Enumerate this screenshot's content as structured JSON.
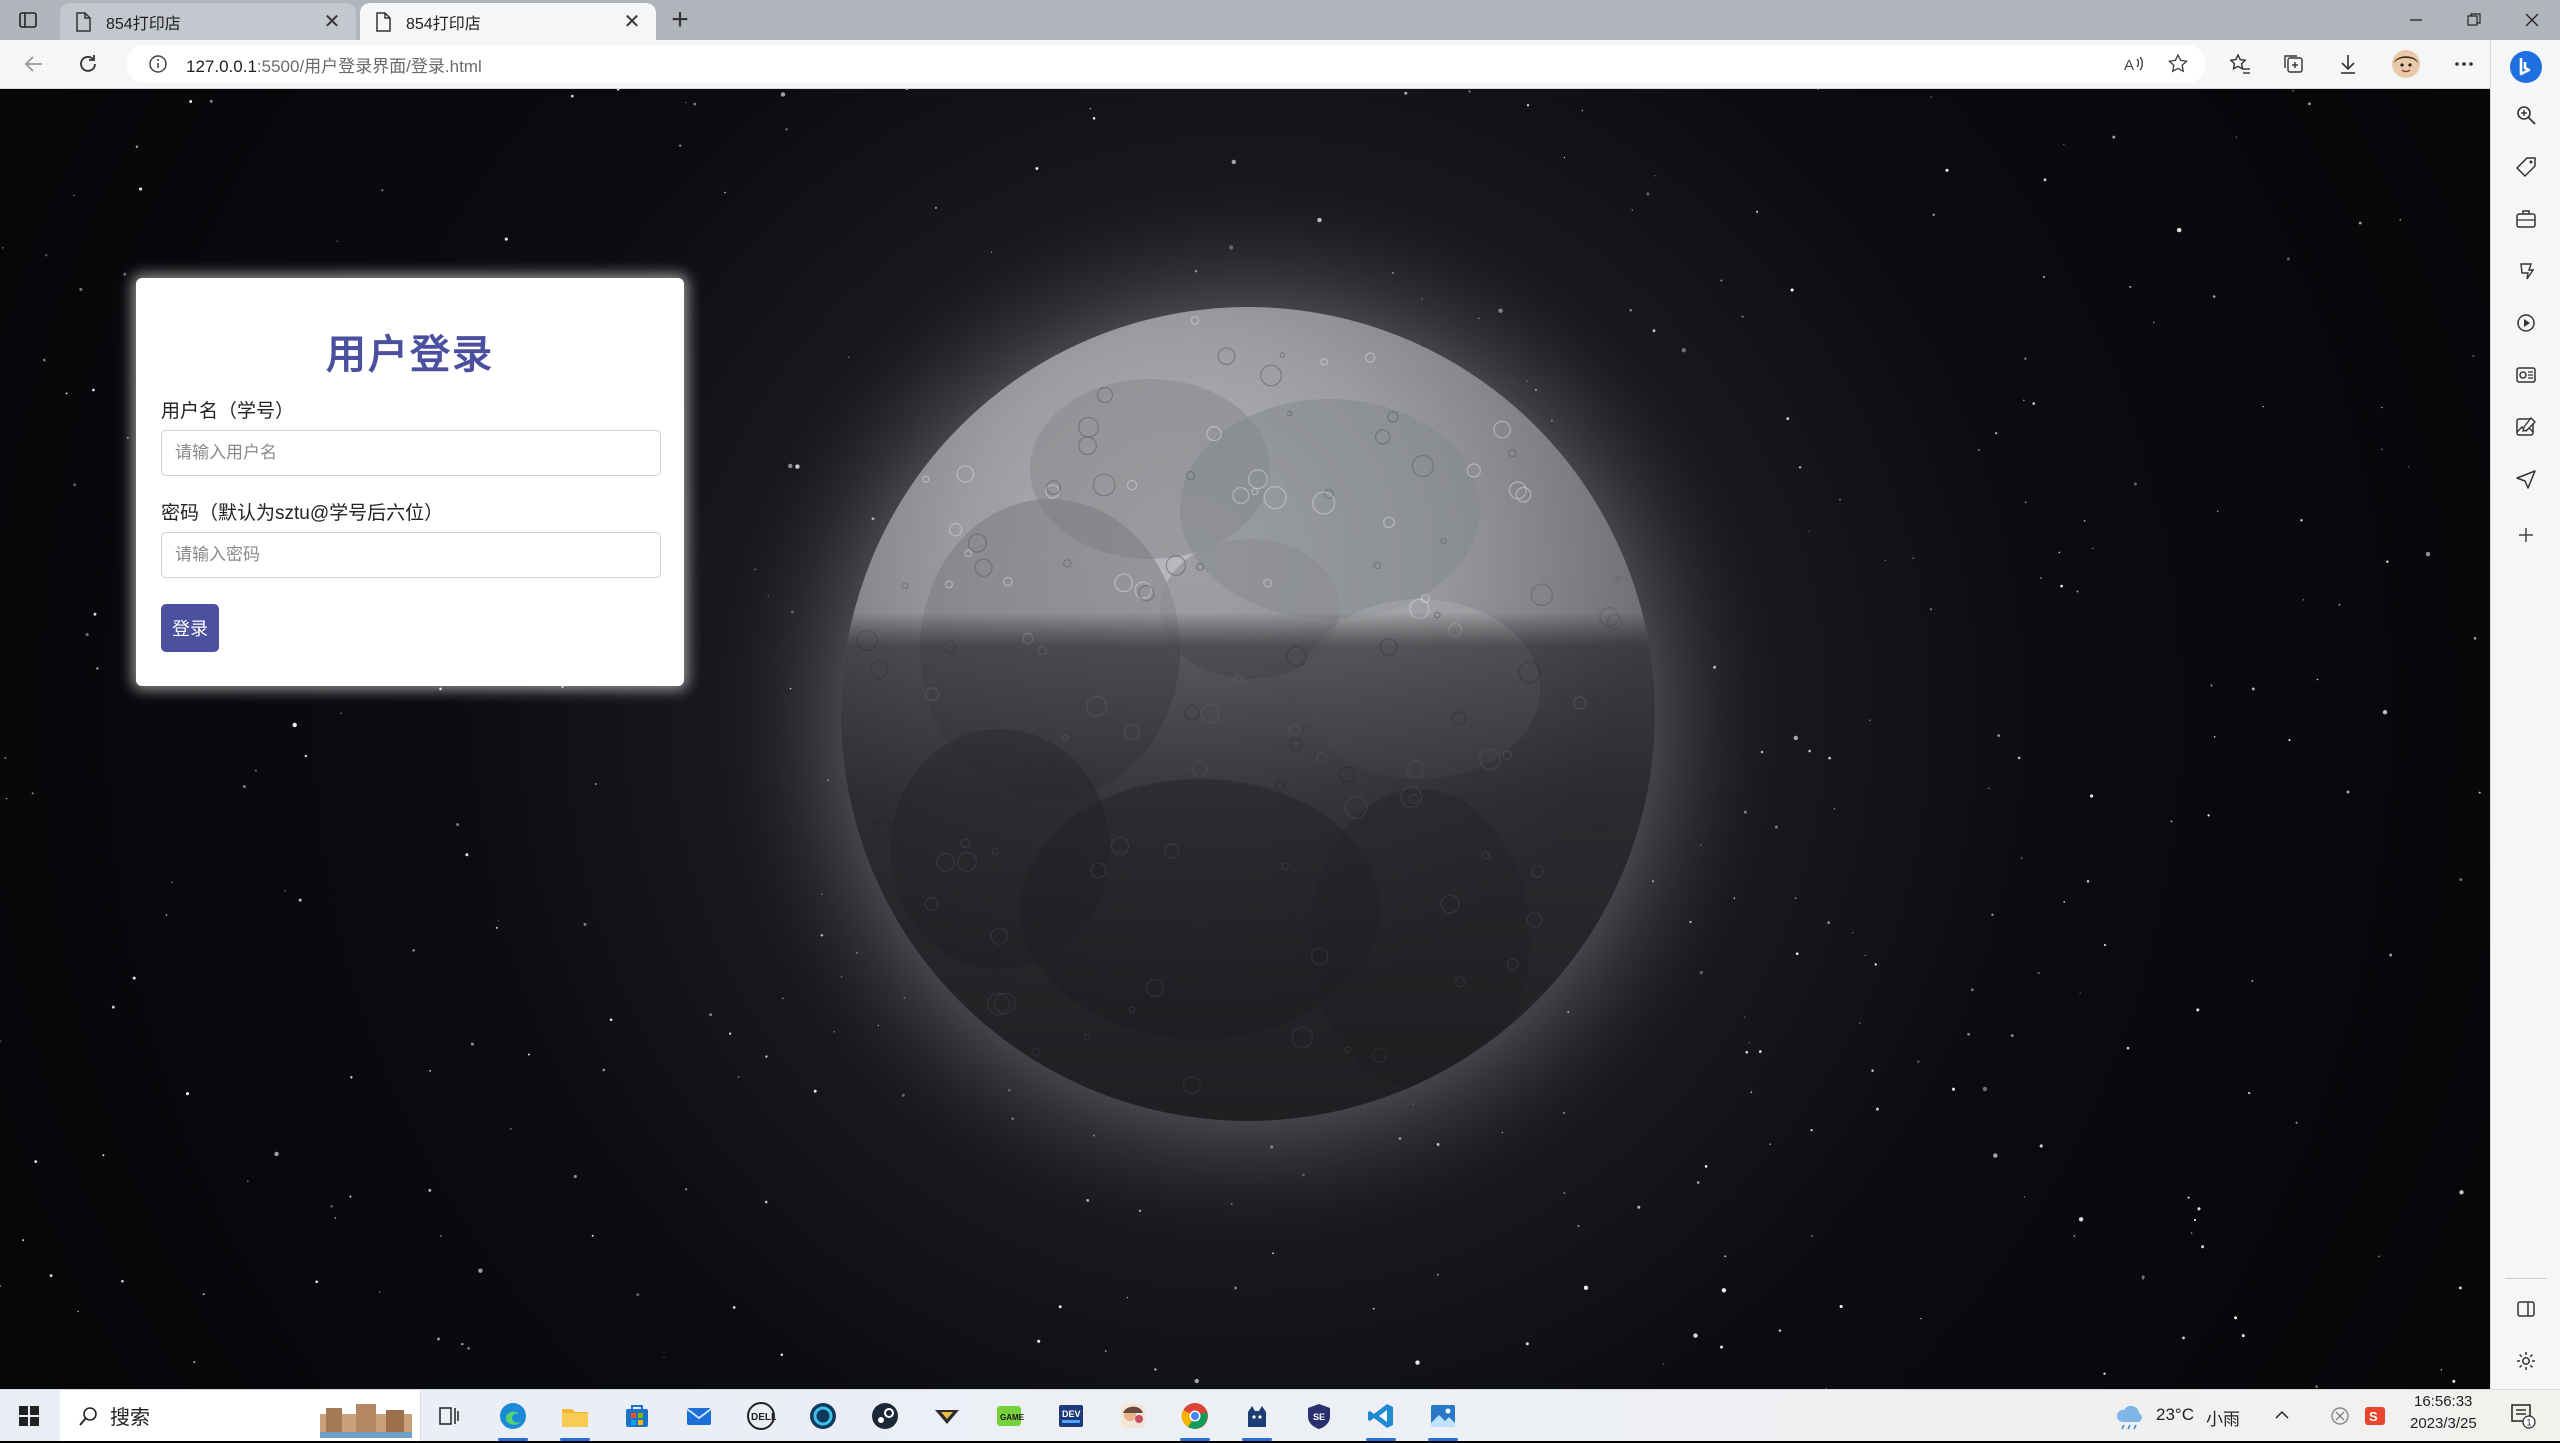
{
  "browser": {
    "tabs": [
      {
        "title": "854打印店",
        "active": false
      },
      {
        "title": "854打印店",
        "active": true
      }
    ],
    "address": {
      "host": "127.0.0.1",
      "rest": ":5500/用户登录界面/登录.html"
    }
  },
  "login": {
    "title": "用户登录",
    "username_label": "用户名（学号）",
    "username_placeholder": "请输入用户名",
    "password_label": "密码（默认为sztu@学号后六位）",
    "password_placeholder": "请输入密码",
    "submit_label": "登录"
  },
  "taskbar": {
    "search_text": "搜索",
    "weather_temp": "23°C",
    "weather_desc": "小雨",
    "time": "16:56:33",
    "date": "2023/3/25"
  },
  "colors": {
    "accent": "#4b519f",
    "title": "#4a4f9e",
    "edge_blue": "#2b6fd6"
  }
}
